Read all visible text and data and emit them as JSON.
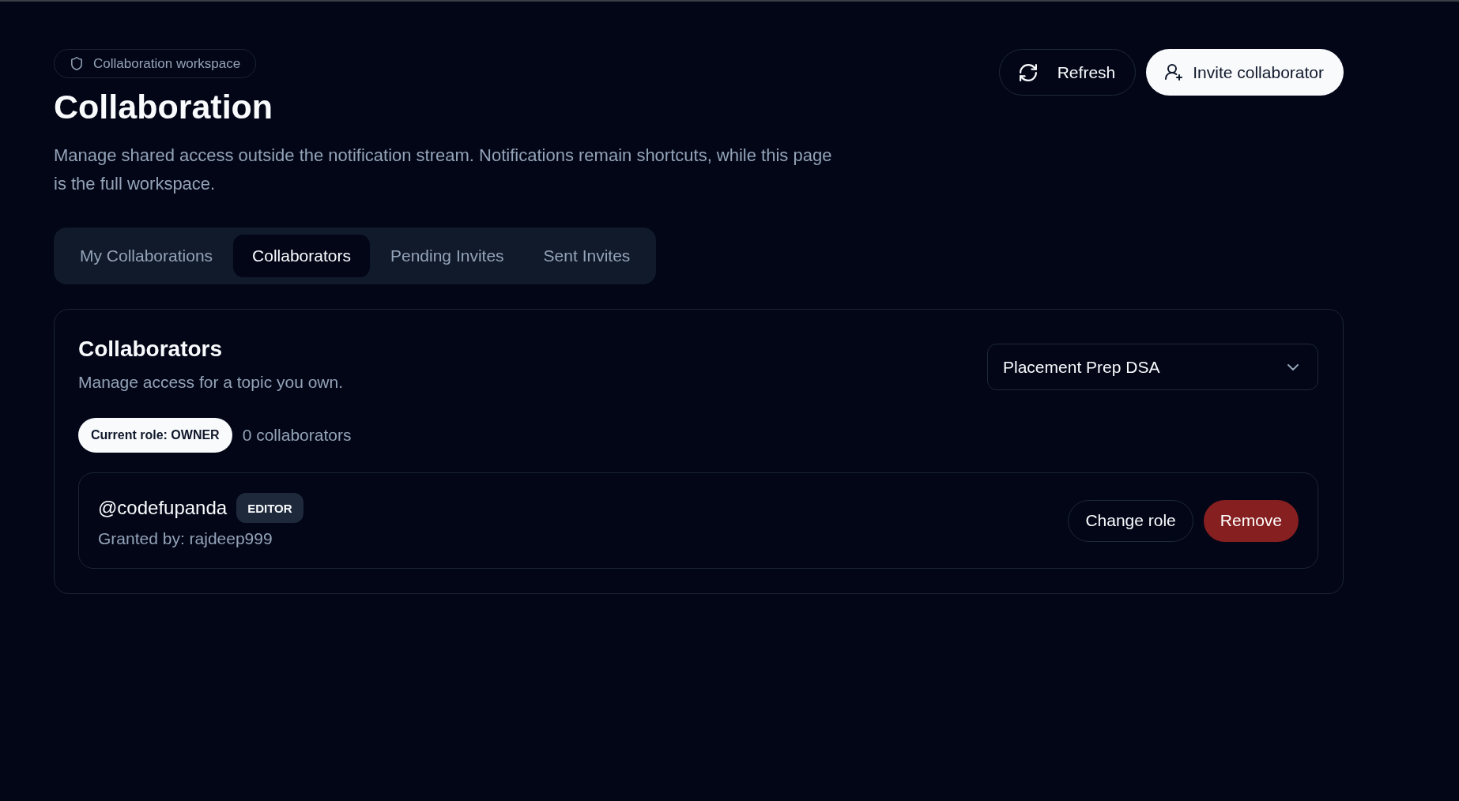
{
  "header": {
    "badge": "Collaboration workspace",
    "title": "Collaboration",
    "description": "Manage shared access outside the notification stream. Notifications remain shortcuts, while this page is the full workspace."
  },
  "actions": [
    {
      "label": "Refresh",
      "kind": "secondary"
    },
    {
      "label": "Invite collaborator",
      "kind": "primary"
    }
  ],
  "tabs": [
    {
      "label": "My Collaborations",
      "selected": false
    },
    {
      "label": "Collaborators",
      "selected": true
    },
    {
      "label": "Pending Invites",
      "selected": false
    },
    {
      "label": "Sent Invites",
      "selected": false
    }
  ],
  "panel": {
    "title": "Collaborators",
    "subtitle": "Manage access for a topic you own.",
    "topic_select": {
      "value": "Placement Prep DSA"
    },
    "role_badge": "Current role: OWNER",
    "count": "0 collaborators",
    "collaborators": [
      {
        "handle": "@codefupanda",
        "role": "EDITOR",
        "granted_by": "Granted by: rajdeep999",
        "actions": [
          {
            "label": "Change role",
            "kind": "outline"
          },
          {
            "label": "Remove",
            "kind": "danger"
          }
        ]
      }
    ]
  }
}
